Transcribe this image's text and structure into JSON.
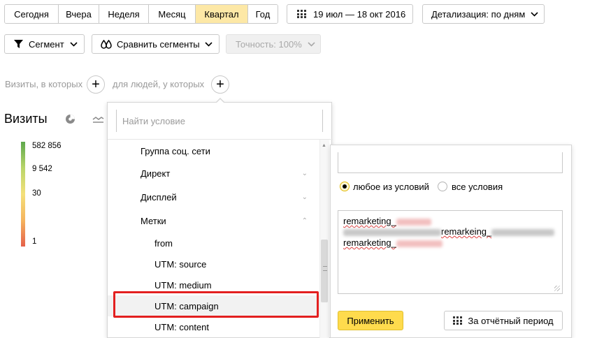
{
  "period": {
    "buttons": [
      {
        "label": "Сегодня"
      },
      {
        "label": "Вчера"
      },
      {
        "label": "Неделя"
      },
      {
        "label": "Месяц"
      },
      {
        "label": "Квартал",
        "active": true
      },
      {
        "label": "Год"
      }
    ],
    "date_range": "19 июл — 18 окт 2016",
    "detail_label": "Детализация: по дням"
  },
  "toolbar": {
    "segment_label": "Сегмент",
    "compare_label": "Сравнить сегменты",
    "accuracy_label": "Точность: 100%"
  },
  "segment_builder": {
    "visits_label": "Визиты, в которых",
    "people_label": "для людей, у которых"
  },
  "report": {
    "title": "Визиты",
    "legend": [
      "582 856",
      "9 542",
      "30",
      "1"
    ]
  },
  "dropdown": {
    "search_placeholder": "Найти условие",
    "items": [
      {
        "label": "Группа соц. сети"
      },
      {
        "label": "Директ"
      },
      {
        "label": "Дисплей"
      },
      {
        "label": "Метки"
      },
      {
        "label": "from"
      },
      {
        "label": "UTM: source"
      },
      {
        "label": "UTM: medium"
      },
      {
        "label": "UTM: campaign"
      },
      {
        "label": "UTM: content"
      }
    ]
  },
  "condition_panel": {
    "radio_any": "любое из условий",
    "radio_all": "все условия",
    "lines": [
      "remarketing_",
      "remarkeing_",
      "remarketing_"
    ],
    "apply_label": "Применить",
    "period_label": "За отчётный период"
  },
  "colors": {
    "active_segment": "#fde8a6",
    "apply_button": "#ffdb4d",
    "highlight_border": "#e32020"
  }
}
